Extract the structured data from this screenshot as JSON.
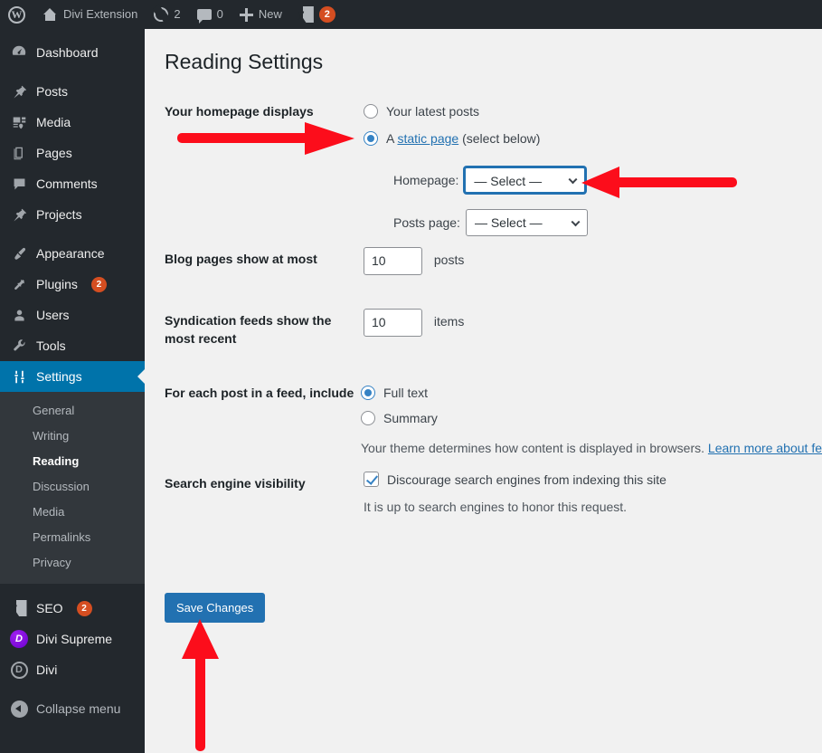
{
  "adminbar": {
    "site_title": "Divi Extension",
    "updates_count": "2",
    "comments_count": "0",
    "new_label": "New",
    "seo_badge": "2",
    "icons": {
      "wp_logo": "wordpress-logo-icon",
      "home": "home-icon",
      "updates": "refresh-icon",
      "comments": "comment-bubble-icon",
      "new": "plus-icon",
      "seo": "yoast-seo-icon"
    }
  },
  "sidebar": {
    "items": [
      {
        "label": "Dashboard",
        "icon": "dashboard-icon",
        "badge": ""
      },
      {
        "label": "Posts",
        "icon": "pin-icon",
        "badge": ""
      },
      {
        "label": "Media",
        "icon": "media-icon",
        "badge": ""
      },
      {
        "label": "Pages",
        "icon": "pages-icon",
        "badge": ""
      },
      {
        "label": "Comments",
        "icon": "comment-bubble-icon",
        "badge": ""
      },
      {
        "label": "Projects",
        "icon": "pin-icon",
        "badge": ""
      },
      {
        "label": "Appearance",
        "icon": "paintbrush-icon",
        "badge": ""
      },
      {
        "label": "Plugins",
        "icon": "plug-icon",
        "badge": "2"
      },
      {
        "label": "Users",
        "icon": "user-icon",
        "badge": ""
      },
      {
        "label": "Tools",
        "icon": "wrench-icon",
        "badge": ""
      },
      {
        "label": "Settings",
        "icon": "sliders-icon",
        "badge": ""
      }
    ],
    "submenu": [
      {
        "label": "General"
      },
      {
        "label": "Writing"
      },
      {
        "label": "Reading"
      },
      {
        "label": "Discussion"
      },
      {
        "label": "Media"
      },
      {
        "label": "Permalinks"
      },
      {
        "label": "Privacy"
      }
    ],
    "plugins_group": [
      {
        "label": "SEO",
        "icon": "yoast-seo-icon",
        "badge": "2"
      },
      {
        "label": "Divi Supreme",
        "icon": "divi-supreme-icon",
        "badge": ""
      },
      {
        "label": "Divi",
        "icon": "divi-icon",
        "badge": ""
      }
    ],
    "collapse_label": "Collapse menu",
    "active_item": "Settings",
    "active_subitem": "Reading"
  },
  "page": {
    "title": "Reading Settings"
  },
  "homepage_displays": {
    "label": "Your homepage displays",
    "option_latest": "Your latest posts",
    "option_static_prefix": "A ",
    "option_static_link": "static page",
    "option_static_suffix": " (select below)",
    "selected": "static"
  },
  "homepage_select": {
    "label": "Homepage:",
    "value": "— Select —",
    "options": [
      "— Select —"
    ],
    "focused": true
  },
  "posts_page_select": {
    "label": "Posts page:",
    "value": "— Select —",
    "options": [
      "— Select —"
    ],
    "focused": false
  },
  "blog_pages": {
    "label": "Blog pages show at most",
    "value": "10",
    "unit": "posts"
  },
  "syndication": {
    "label": "Syndication feeds show the most recent",
    "value": "10",
    "unit": "items"
  },
  "feed_include": {
    "label": "For each post in a feed, include",
    "option_full": "Full text",
    "option_summary": "Summary",
    "selected": "full",
    "description": "Your theme determines how content is displayed in browsers. ",
    "description_link": "Learn more about fe"
  },
  "search_visibility": {
    "label": "Search engine visibility",
    "checkbox_label": "Discourage search engines from indexing this site",
    "checked": true,
    "note": "It is up to search engines to honor this request."
  },
  "save": {
    "label": "Save Changes"
  },
  "annotations": {
    "arrow_color": "#fc0d1b",
    "arrows": [
      {
        "name": "arrow-to-static-page-radio",
        "direction": "right"
      },
      {
        "name": "arrow-to-homepage-select",
        "direction": "left"
      },
      {
        "name": "arrow-to-save-changes",
        "direction": "up"
      }
    ]
  },
  "colors": {
    "admin_bar": "#23282d",
    "sidebar": "#23282d",
    "submenu": "#32373c",
    "active": "#0073aa",
    "primary_button": "#2271b1",
    "badge": "#d54e21",
    "content_bg": "#f1f1f1"
  }
}
